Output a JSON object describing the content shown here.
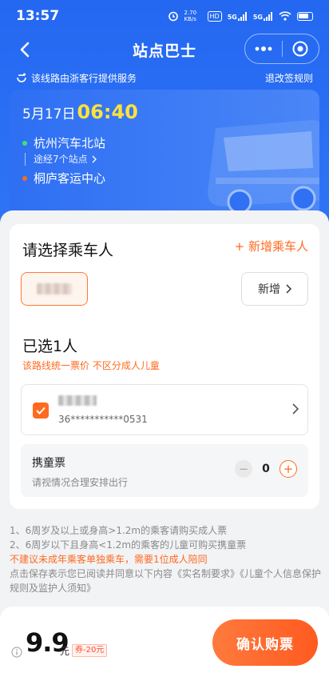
{
  "status_bar": {
    "time": "13:57",
    "net_speed": "2.70 KB/s",
    "hd_badge": "HD",
    "signal1": "5G",
    "signal2": "5G"
  },
  "nav": {
    "title": "站点巴士"
  },
  "provider": {
    "text": "该线路由浙客行提供服务",
    "refund_link": "退改签规则"
  },
  "trip": {
    "date": "5月17日",
    "time": "06:40",
    "origin": "杭州汽车北站",
    "via": "途经7个站点",
    "destination": "桐庐客运中心",
    "colors": {
      "origin_dot": "#3ee46a",
      "destination_dot": "#ff6a1f",
      "time": "#ffe23c"
    }
  },
  "passenger": {
    "title": "请选择乘车人",
    "add_label": "+ 新增乘车人",
    "new_button": "新增"
  },
  "selected": {
    "title": "已选1人",
    "note": "该路线统一票价 不区分成人儿童",
    "passenger_id": "36***********0531"
  },
  "child_ticket": {
    "title": "携童票",
    "subtitle": "请视情况合理安排出行",
    "count": "0",
    "minus": "−",
    "plus": "+"
  },
  "rules": {
    "line1": "1、6周岁及以上或身高>1.2m的乘客请购买成人票",
    "line2": "2、6周岁以下且身高<1.2m的乘客的儿童可购买携童票",
    "warning": "不建议未成年乘客单独乘车，需要1位成人陪同",
    "agree_prefix": "点击保存表示您已阅读并同意以下内容",
    "link1": "《实名制要求》",
    "link2": "《儿童个人信息保护规则及监护人须知》"
  },
  "bottom": {
    "price": "9.9",
    "unit": "元",
    "coupon": "券-20元",
    "buy_button": "确认购票"
  },
  "colors": {
    "primary": "#2468f2",
    "accent": "#ff6a1f"
  }
}
